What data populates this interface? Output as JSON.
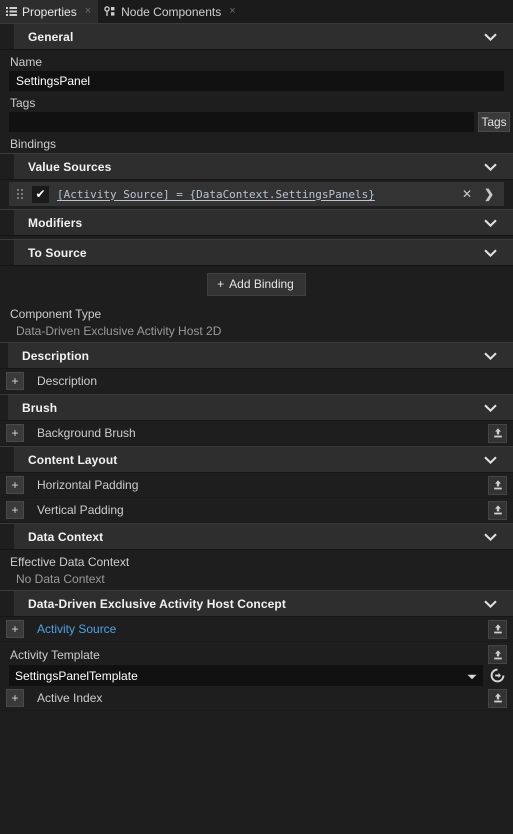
{
  "tabs": [
    {
      "label": "Properties",
      "icon": "list-icon",
      "close": "×",
      "active": true
    },
    {
      "label": "Node Components",
      "icon": "node-components-icon",
      "close": "×",
      "active": false
    }
  ],
  "sections": {
    "general": "General",
    "value_sources": "Value Sources",
    "modifiers": "Modifiers",
    "to_source": "To Source",
    "description": "Description",
    "brush": "Brush",
    "content_layout": "Content Layout",
    "data_context": "Data Context",
    "concept": "Data-Driven Exclusive Activity Host Concept"
  },
  "general": {
    "name_label": "Name",
    "name_value": "SettingsPanel",
    "tags_label": "Tags",
    "tags_value": "",
    "tags_placeholder": "",
    "tags_button": "Tags",
    "bindings_label": "Bindings"
  },
  "binding": {
    "checked": true,
    "check_glyph": "✔",
    "expression": "[Activity Source] = {DataContext.SettingsPanels}",
    "remove_glyph": "✕",
    "next_glyph": "❯",
    "add_label": "Add Binding",
    "add_plus": "+"
  },
  "component": {
    "type_label": "Component Type",
    "type_value": "Data-Driven Exclusive Activity Host 2D"
  },
  "rows": {
    "description": {
      "plus": "+",
      "label": "Description"
    },
    "background_brush": {
      "plus": "+",
      "label": "Background Brush"
    },
    "horizontal_padding": {
      "plus": "+",
      "label": "Horizontal Padding"
    },
    "vertical_padding": {
      "plus": "+",
      "label": "Vertical Padding"
    },
    "activity_source": {
      "plus": "+",
      "label": "Activity Source",
      "linked": true
    },
    "active_index": {
      "plus": "+",
      "label": "Active Index"
    }
  },
  "data_context": {
    "effective_label": "Effective Data Context",
    "effective_value": "No Data Context"
  },
  "activity_template": {
    "label": "Activity Template",
    "value": "SettingsPanelTemplate"
  },
  "icons": {
    "chevron_down": "chevron-down-icon",
    "upload": "upload-icon",
    "goto": "goto-icon"
  },
  "colors": {
    "background": "#1e1e1e",
    "section_header": "#2e2e2e",
    "input_bg": "#111111",
    "link": "#4ea3e3",
    "text": "#cdcdcd",
    "binding_text": "#b8c4d0"
  }
}
